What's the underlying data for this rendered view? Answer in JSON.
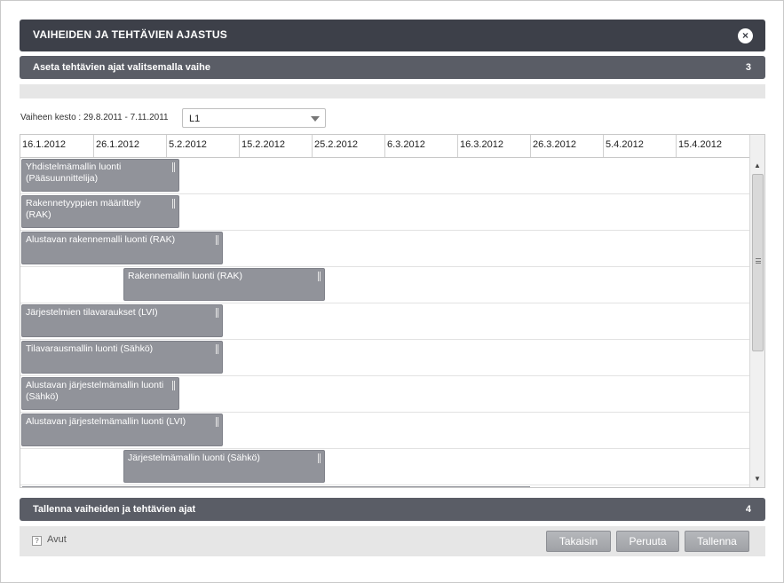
{
  "dialog": {
    "title": "VAIHEIDEN JA TEHTÄVIEN AJASTUS",
    "close_icon": "×"
  },
  "step3": {
    "label": "Aseta tehtävien ajat valitsemalla vaihe",
    "number": "3"
  },
  "phase": {
    "duration_text": "Vaiheen kesto : 29.8.2011 - 7.11.2011",
    "selected": "L1"
  },
  "timeline": {
    "dates": [
      "16.1.2012",
      "26.1.2012",
      "5.2.2012",
      "15.2.2012",
      "25.2.2012",
      "6.3.2012",
      "16.3.2012",
      "26.3.2012",
      "5.4.2012",
      "15.4.2012"
    ]
  },
  "tasks": [
    {
      "name": "Yhdistelmämallin luonti (Pääsuunnittelija)"
    },
    {
      "name": "Rakennetyyppien määrittely (RAK)"
    },
    {
      "name": "Alustavan rakennemalli luonti (RAK)"
    },
    {
      "name": "Rakennemallin luonti (RAK)"
    },
    {
      "name": "Järjestelmien tilavaraukset (LVI)"
    },
    {
      "name": "Tilavarausmallin luonti (Sähkö)"
    },
    {
      "name": "Alustavan järjestelmämallin luonti (Sähkö)"
    },
    {
      "name": "Alustavan järjestelmämallin luonti (LVI)"
    },
    {
      "name": "Järjestelmämallin luonti (Sähkö)"
    }
  ],
  "step4": {
    "label": "Tallenna vaiheiden ja tehtävien ajat",
    "number": "4"
  },
  "footer": {
    "help_icon": "?",
    "help_label": "Avut",
    "back_label": "Takaisin",
    "cancel_label": "Peruuta",
    "save_label": "Tallenna"
  },
  "scrollbar": {
    "up_icon": "▲",
    "down_icon": "▼"
  }
}
